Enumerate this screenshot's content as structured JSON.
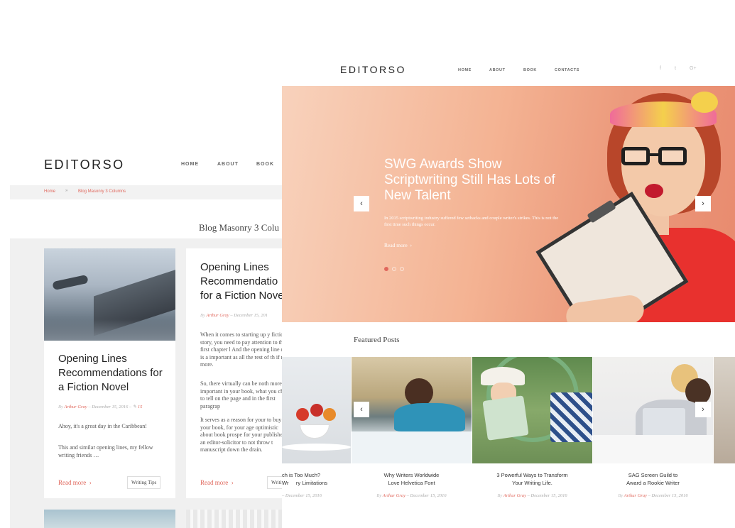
{
  "back": {
    "logo": "EDITORSO",
    "nav": [
      "HOME",
      "ABOUT",
      "BOOK"
    ],
    "breadcrumb": {
      "home": "Home",
      "separator": "»",
      "current": "Blog Masonry 3 Columns"
    },
    "page_title": "Blog Masonry 3 Colu",
    "card1": {
      "title": "Opening Lines Recommendations for a Fiction Novel",
      "meta_by": "By",
      "author": "Arthur Gray",
      "date": "December 15, 2016",
      "comments": "15",
      "excerpt1": "Ahoy, it's a great day in the Caribbean!",
      "excerpt2": "This and similar opening lines, my fellow writing friends …",
      "read_more": "Read more",
      "tag": "Writing Tips"
    },
    "card2": {
      "title": "Opening Lines Recommendatio for a Fiction Nove",
      "meta_by": "By",
      "author": "Arthur Gray",
      "date": "December 15, 201",
      "excerpt1": "When it comes to starting up y fiction story, you need to pay attention to the first chapter l And the opening line of it is a important as all the rest of th if not more.",
      "excerpt2": "So, there virtually can be noth more important in your book, what you chose to tell on the page and in the first paragrap",
      "excerpt3": "It serves as a reason for your to buy your book, for your age optimistic about book prospe for your publisher or an editor-solicitor to not throw t manuscript down the drain.",
      "read_more": "Read more",
      "tag": "Writing"
    }
  },
  "front": {
    "logo": "EDITORSO",
    "nav": [
      "HOME",
      "ABOUT",
      "BOOK",
      "CONTACTS"
    ],
    "social": [
      "f",
      "t",
      "G+"
    ],
    "hero": {
      "title": "SWG Awards Show Scriptwriting Still Has Lots of New Talent",
      "text": "In 2015 scriptwriting industry suffered few setbacks and couple writer's strikes. This is not the first time such things occur.",
      "read_more": "Read more",
      "prev": "‹",
      "next": "›"
    },
    "featured_heading": "Featured Posts",
    "posts": [
      {
        "title": "ch is Too Much? ... ry Limitations",
        "line1": "ch is Too Much?",
        "line2": "Wr     ry Limitations",
        "by": "By",
        "author": "",
        "date": "December 15, 2016"
      },
      {
        "line1": "Why Writers Worldwide",
        "line2": "Love Helvetica Font",
        "by": "By",
        "author": "Arthur Gray",
        "date": "December 15, 2016"
      },
      {
        "line1": "3 Powerful Ways to Transform",
        "line2": "Your Writing Life.",
        "by": "By",
        "author": "Arthur Gray",
        "date": "December 15, 2016"
      },
      {
        "line1": "SAG Screen Guild to",
        "line2": "Award a Rookie Writer",
        "by": "By",
        "author": "Arthur Gray",
        "date": "December 15, 2016"
      }
    ],
    "carousel_prev": "‹",
    "carousel_next": "›"
  },
  "colors": {
    "accent": "#e0675c",
    "hero_start": "#f8d2bc",
    "hero_end": "#e88a6e"
  }
}
